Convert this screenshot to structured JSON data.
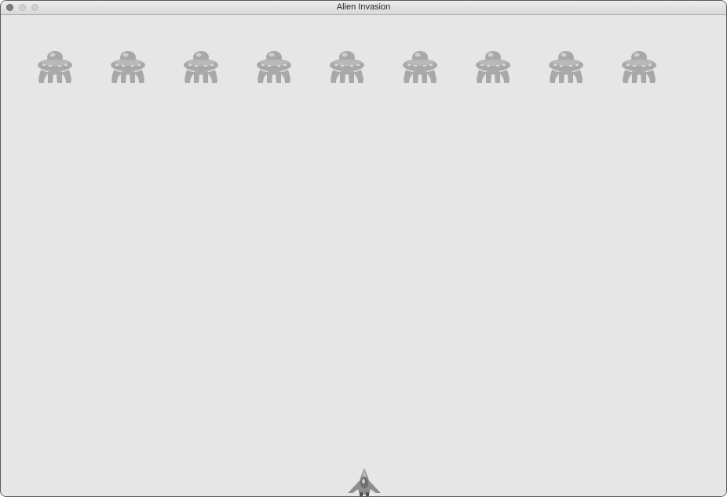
{
  "window": {
    "title": "Alien Invasion"
  },
  "icons": {
    "alien": "ufo-alien-icon",
    "ship": "player-ship-icon"
  },
  "game": {
    "alien_count": 9,
    "background_color": "#e6e6e6",
    "alien_color": "#a8a8a8",
    "ship_color": "#8a8a8a"
  }
}
